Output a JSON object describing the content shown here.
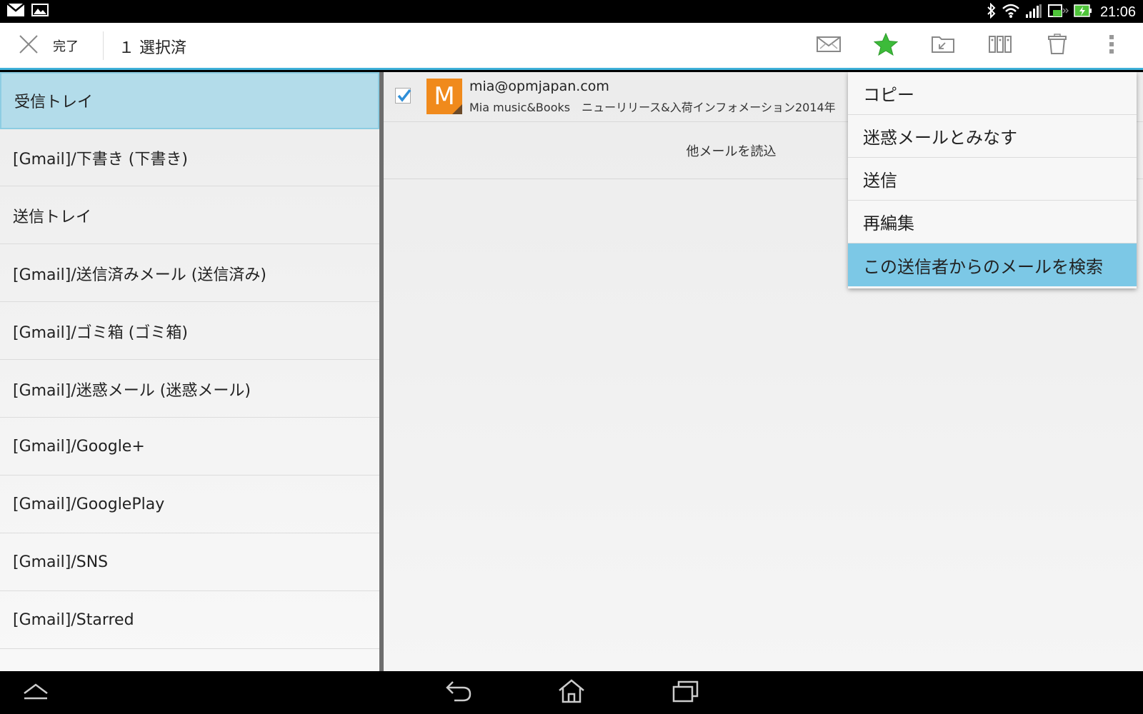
{
  "status_bar": {
    "time": "21:06",
    "left_icons": [
      "mail-icon",
      "image-icon"
    ],
    "right_icons": [
      "bluetooth-icon",
      "wifi-icon",
      "signal-icon",
      "battery-charging-icon"
    ]
  },
  "action_bar": {
    "done_label": "完了",
    "selected_count": "１ 選択済",
    "actions": [
      "mail-icon",
      "star-icon",
      "move-folder-icon",
      "columns-icon",
      "trash-icon",
      "overflow-menu-icon"
    ],
    "accent_color": "#3fb1d9",
    "star_color": "#3dbb3a"
  },
  "folders": [
    {
      "label": "受信トレイ",
      "selected": true
    },
    {
      "label": "[Gmail]/下書き (下書き)"
    },
    {
      "label": "送信トレイ"
    },
    {
      "label": "[Gmail]/送信済みメール (送信済み)"
    },
    {
      "label": "[Gmail]/ゴミ箱 (ゴミ箱)"
    },
    {
      "label": "[Gmail]/迷惑メール (迷惑メール)"
    },
    {
      "label": "[Gmail]/Google+"
    },
    {
      "label": "[Gmail]/GooglePlay"
    },
    {
      "label": "[Gmail]/SNS"
    },
    {
      "label": "[Gmail]/Starred"
    }
  ],
  "mail": {
    "checked": true,
    "avatar_letter": "M",
    "avatar_color": "#f08a1c",
    "from": "mia@opmjapan.com",
    "subject": "Mia music&Books　ニューリリース&入荷インフォメーション2014年"
  },
  "load_more_label": "他メールを読込",
  "context_menu": {
    "items": [
      {
        "label": "コピー"
      },
      {
        "label": "迷惑メールとみなす"
      },
      {
        "label": "送信"
      },
      {
        "label": "再編集"
      },
      {
        "label": "この送信者からのメールを検索",
        "highlighted": true
      }
    ],
    "highlight_color": "#7cc8e6"
  },
  "nav_bar": {
    "buttons": [
      "up-arrow-icon",
      "back-icon",
      "home-icon",
      "recent-apps-icon"
    ]
  }
}
